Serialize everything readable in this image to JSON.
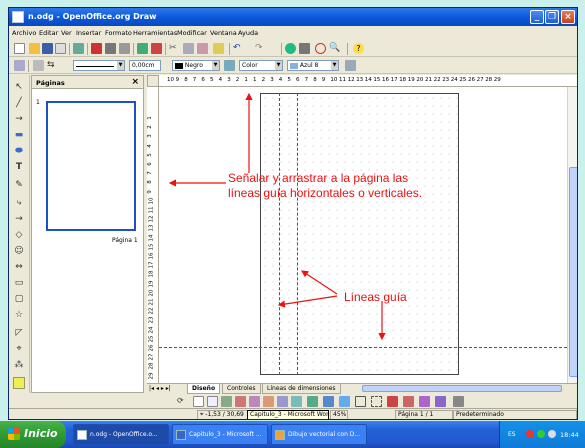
{
  "window": {
    "title": "n.odg - OpenOffice.org Draw"
  },
  "menu": [
    "Archivo",
    "Editar",
    "Ver",
    "Insertar",
    "Formato",
    "Herramientas",
    "Modificar",
    "Ventana",
    "Ayuda"
  ],
  "line_toolbar": {
    "width_value": "0,00cm",
    "line_color": "Negro",
    "area_style": "Color",
    "area_color": "Azul 8"
  },
  "slides_panel": {
    "title": "Páginas",
    "close": "×",
    "slide_number": "1",
    "slide_label": "Página 1"
  },
  "rulers": {
    "horizontal": [
      "10",
      "9",
      "8",
      "7",
      "6",
      "5",
      "4",
      "3",
      "2",
      "1",
      "1",
      "2",
      "3",
      "4",
      "5",
      "6",
      "7",
      "8",
      "9",
      "10",
      "11",
      "12",
      "13",
      "14",
      "15",
      "16",
      "17",
      "18",
      "19",
      "20",
      "21",
      "22",
      "23",
      "24",
      "25",
      "26",
      "27",
      "28",
      "29"
    ],
    "vertical": [
      "1",
      "2",
      "3",
      "4",
      "5",
      "6",
      "7",
      "8",
      "9",
      "10",
      "11",
      "12",
      "13",
      "14",
      "15",
      "16",
      "17",
      "18",
      "19",
      "20",
      "21",
      "22",
      "23",
      "24",
      "25",
      "26",
      "27",
      "28",
      "29"
    ]
  },
  "annotations": {
    "drag_line1": "Señalar y arrastrar a la página las",
    "drag_line2": "líneas guía horizontales o verticales.",
    "guides_label": "Líneas guía"
  },
  "tabs": [
    "Diseño",
    "Controles",
    "Líneas de dimensiones"
  ],
  "status": {
    "position": "-1,53 / 30,69",
    "tooltip": "Capitulo_3 - Microsoft Word",
    "zoom": "45%",
    "page": "Página 1 / 1",
    "style": "Predeterminado"
  },
  "taskbar": {
    "start": "Inicio",
    "tasks": [
      "n.odg - OpenOffice.o...",
      "Capitulo_3 - Microsoft ...",
      "Dibujo vectorial con D..."
    ],
    "lang": "ES",
    "time": "18:44"
  },
  "colors": {
    "annotation": "#ee1111",
    "accent": "#1e4fc3",
    "taskbar": "#2462d8",
    "start": "#2f9a32"
  }
}
